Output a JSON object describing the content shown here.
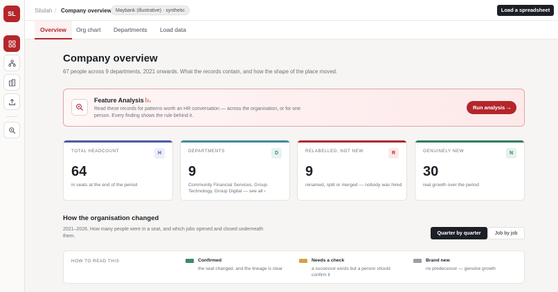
{
  "app": {
    "logo_initials": "SL"
  },
  "breadcrumb": {
    "root": "Silsilah",
    "separator": "/",
    "current": "Company overview"
  },
  "dataset_badge": "Maybank (illustrative) · synthetic",
  "actions": {
    "load_spreadsheet": "Load a spreadsheet"
  },
  "tabs": [
    {
      "label": "Overview",
      "active": true
    },
    {
      "label": "Org chart",
      "active": false
    },
    {
      "label": "Departments",
      "active": false
    },
    {
      "label": "Load data",
      "active": false
    }
  ],
  "rail_icons": [
    "overview-grid-icon",
    "org-chart-icon",
    "departments-icon",
    "upload-icon",
    "search-icon"
  ],
  "page": {
    "title": "Company overview",
    "subtitle": "67 people across 9 departments, 2021 onwards. What the records contain, and how the shape of the place moved."
  },
  "feature": {
    "title": "Feature Analysis",
    "description": "Read these records for patterns worth an HR conversation — across the organisation, or for one person. Every finding shows the rule behind it.",
    "button": "Run analysis",
    "icon": "search-icon",
    "accent": "#b3262b"
  },
  "stats": [
    {
      "label": "TOTAL HEADCOUNT",
      "chip": "H",
      "value": "64",
      "description": "in seats at the end of the period",
      "color": "#4b5aa6"
    },
    {
      "label": "DEPARTMENTS",
      "chip": "D",
      "value": "9",
      "description": "Community Financial Services, Group Technology, Group Digital — see all ›",
      "color": "#3d8ba0"
    },
    {
      "label": "RELABELLED, NOT NEW",
      "chip": "R",
      "value": "9",
      "description": "renamed, split or merged — nobody was hired",
      "color": "#b3262b"
    },
    {
      "label": "GENUINELY NEW",
      "chip": "N",
      "value": "30",
      "description": "real growth over the period",
      "color": "#2f7d5b"
    }
  ],
  "section": {
    "title": "How the organisation changed",
    "subtitle": "2021–2026. How many people were in a seat, and which jobs opened and closed underneath them.",
    "toggle": {
      "on": "Quarter by quarter",
      "off": "Job by job"
    }
  },
  "legend": {
    "heading": "HOW TO READ THIS",
    "items": [
      {
        "name": "Confirmed",
        "description": "the seat changed, and the lineage is clear",
        "color": "#3e8a66"
      },
      {
        "name": "Needs a check",
        "description": "a successor exists but a person should confirm it",
        "color": "#d4a245"
      },
      {
        "name": "Brand new",
        "description": "no predecessor — genuine growth",
        "color": "#9aa0a6"
      }
    ]
  }
}
